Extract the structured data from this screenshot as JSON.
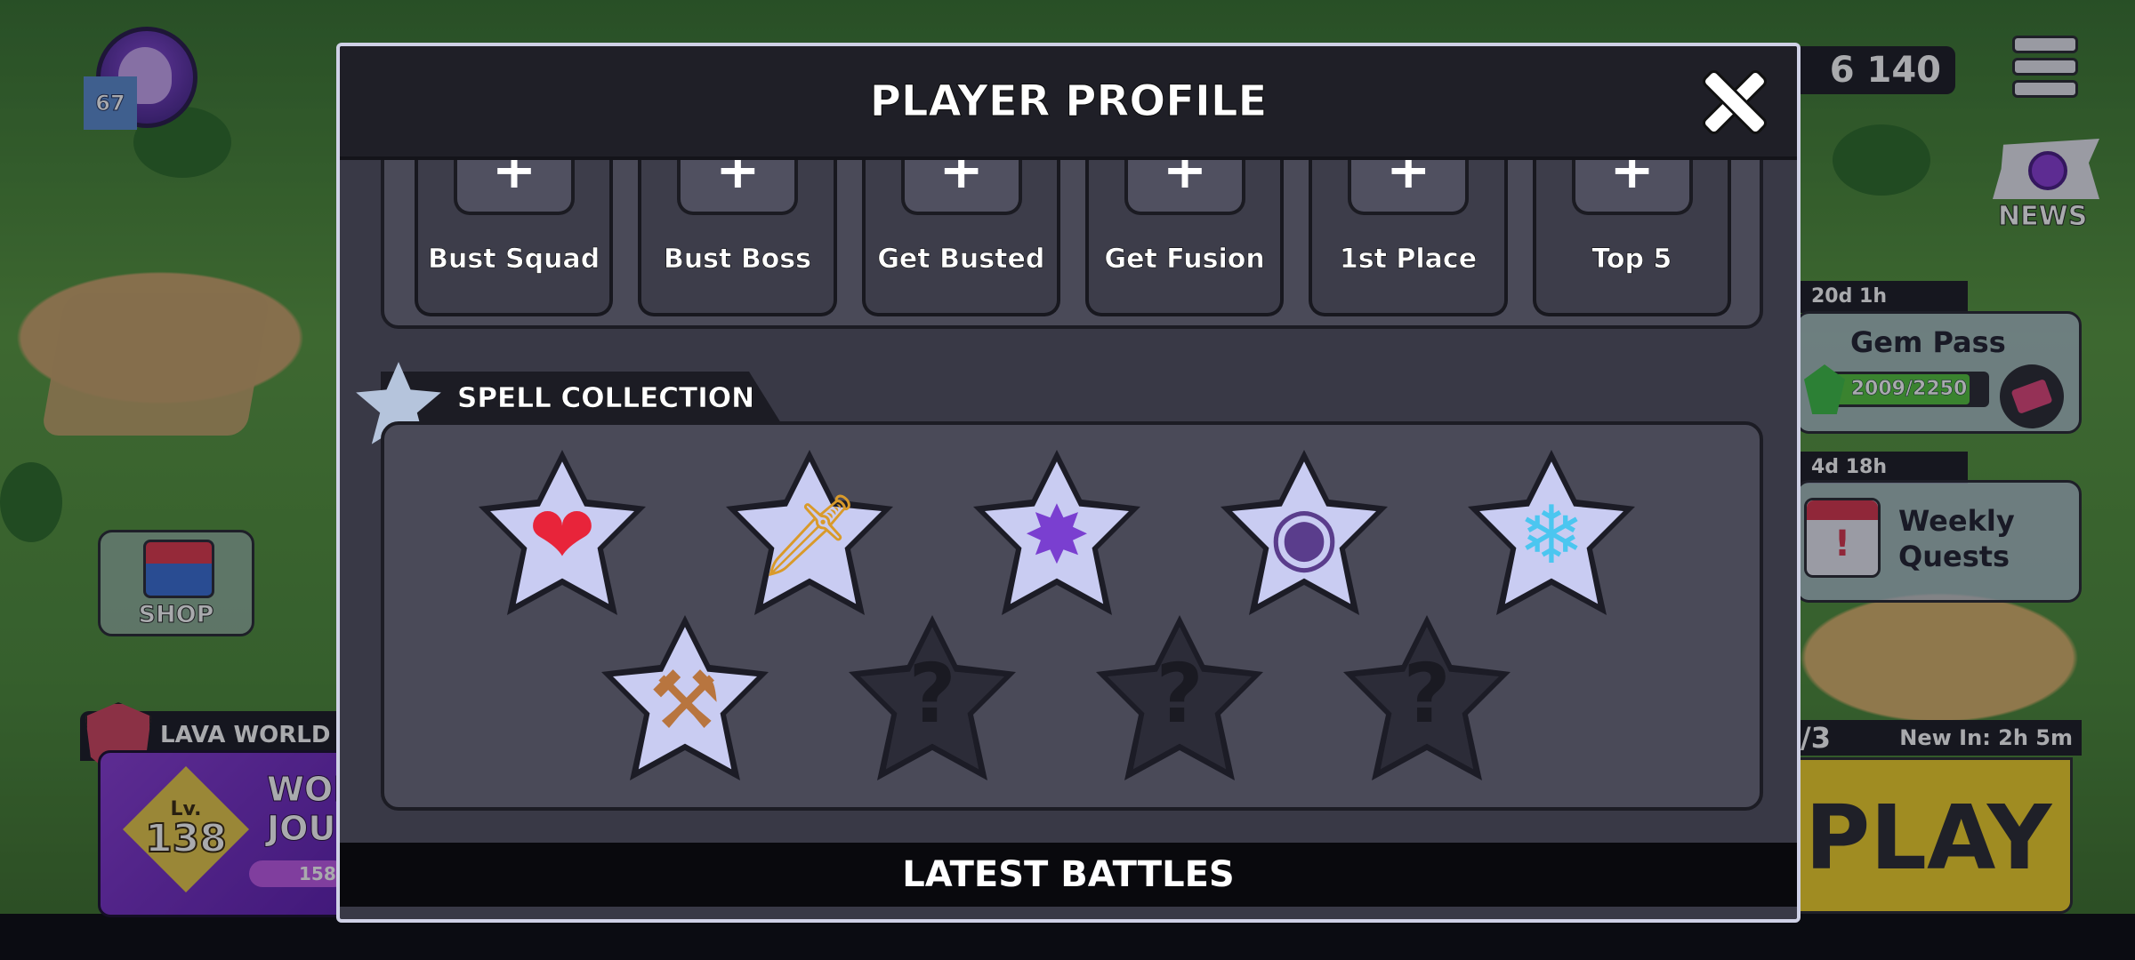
{
  "hud": {
    "player_level": "67",
    "shop_label": "SHOP",
    "world_name": "LAVA WORLD",
    "world_level_prefix": "Lv.",
    "world_level": "138",
    "world_title_partial": "WOI\nJOUI",
    "world_progress_partial": "158",
    "currency": "6 140",
    "news_label": "NEWS",
    "gem_pass_timer": "20d 1h",
    "gem_pass_title": "Gem Pass",
    "gem_pass_progress": "2009/2250",
    "gem_pass_fraction": 0.893,
    "weekly_timer": "4d 18h",
    "weekly_title": "Weekly\nQuests",
    "play_level_partial": "/3",
    "new_in": "New In: 2h 5m",
    "play_label_partial": "PLAY"
  },
  "modal": {
    "title": "PLAYER PROFILE",
    "close_icon": "close-icon",
    "achievements": [
      {
        "label": "Bust Squad",
        "icon": "plus-icon"
      },
      {
        "label": "Bust Boss",
        "icon": "plus-icon"
      },
      {
        "label": "Get Busted",
        "icon": "plus-icon"
      },
      {
        "label": "Get Fusion",
        "icon": "plus-icon"
      },
      {
        "label": "1st Place",
        "icon": "plus-icon"
      },
      {
        "label": "Top 5",
        "icon": "plus-icon"
      }
    ],
    "spell_section_title": "SPELL COLLECTION",
    "spells": [
      {
        "name": "heal-spell-icon",
        "glyph": "❤",
        "color": "#e8243a",
        "locked": false
      },
      {
        "name": "sword-spell-icon",
        "glyph": "🗡",
        "color": "#d99a2a",
        "locked": false
      },
      {
        "name": "bomb-spell-icon",
        "glyph": "✸",
        "color": "#7a3fd0",
        "locked": false
      },
      {
        "name": "cannon-spell-icon",
        "glyph": "◉",
        "color": "#5a3d8c",
        "locked": false
      },
      {
        "name": "freeze-spell-icon",
        "glyph": "❄",
        "color": "#4bc6f0",
        "locked": false
      },
      {
        "name": "hammer-spell-icon",
        "glyph": "⚒",
        "color": "#b8753f",
        "locked": false
      },
      {
        "name": "locked-spell-icon",
        "glyph": "?",
        "color": "#1a1a22",
        "locked": true
      },
      {
        "name": "locked-spell-icon",
        "glyph": "?",
        "color": "#1a1a22",
        "locked": true
      },
      {
        "name": "locked-spell-icon",
        "glyph": "?",
        "color": "#1a1a22",
        "locked": true
      }
    ],
    "latest_battles_title": "LATEST BATTLES"
  }
}
